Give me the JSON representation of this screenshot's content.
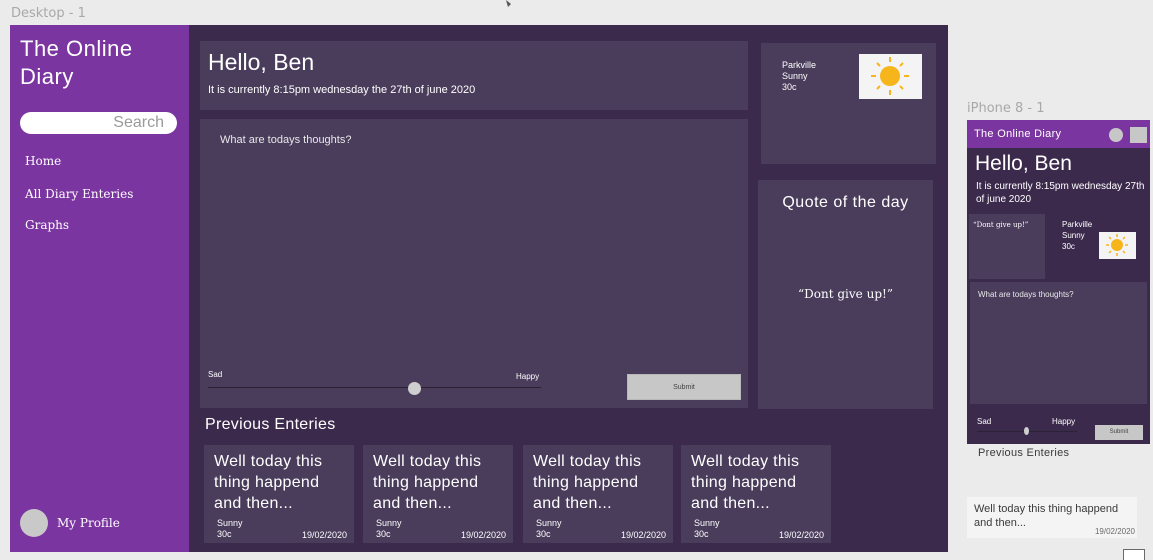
{
  "frames": {
    "desktop_label": "Desktop - 1",
    "phone_label": "iPhone 8 - 1"
  },
  "sidebar": {
    "brand": "The Online Diary",
    "search_placeholder": "Search",
    "nav": [
      {
        "label": "Home"
      },
      {
        "label": "All Diary Enteries"
      },
      {
        "label": "Graphs"
      }
    ],
    "profile_label": "My Profile"
  },
  "greeting": {
    "hello": "Hello, Ben",
    "subtitle": "It is currently 8:15pm wednesday the 27th of june 2020"
  },
  "thoughts": {
    "prompt": "What are todays thoughts?",
    "mood_min_label": "Sad",
    "mood_max_label": "Happy",
    "mood_value": 0.62,
    "submit_label": "Submit"
  },
  "weather": {
    "location": "Parkville",
    "condition": "Sunny",
    "temperature": "30c",
    "icon": "sun-icon",
    "sun_color": "#f7b51c"
  },
  "quote": {
    "title": "Quote of the day",
    "text": "“Dont give up!”"
  },
  "previous": {
    "title": "Previous Enteries",
    "entries": [
      {
        "text": "Well today this thing happend and then...",
        "weather": "Sunny",
        "temp": "30c",
        "date": "19/02/2020"
      },
      {
        "text": "Well today this thing happend and then...",
        "weather": "Sunny",
        "temp": "30c",
        "date": "19/02/2020"
      },
      {
        "text": "Well today this thing happend and then...",
        "weather": "Sunny",
        "temp": "30c",
        "date": "19/02/2020"
      },
      {
        "text": "Well today this thing happend and then...",
        "weather": "Sunny",
        "temp": "30c",
        "date": "19/02/2020"
      }
    ]
  },
  "phone": {
    "brand": "The Online Diary",
    "hello": "Hello, Ben",
    "subtitle": "It is currently 8:15pm wednesday 27th of june 2020",
    "quote": "“Dont give up!”",
    "weather": {
      "location": "Parkville",
      "condition": "Sunny",
      "temperature": "30c"
    },
    "thoughts_prompt": "What are todays thoughts?",
    "mood_min_label": "Sad",
    "mood_max_label": "Happy",
    "submit_label": "Submit",
    "previous_title": "Previous Enteries",
    "entry_text": "Well today this thing happend and then...",
    "entry_date": "19/02/2020"
  },
  "colors": {
    "sidebar": "#7b35a1",
    "background": "#3c2a4d",
    "panel": "#4a3d5c"
  }
}
